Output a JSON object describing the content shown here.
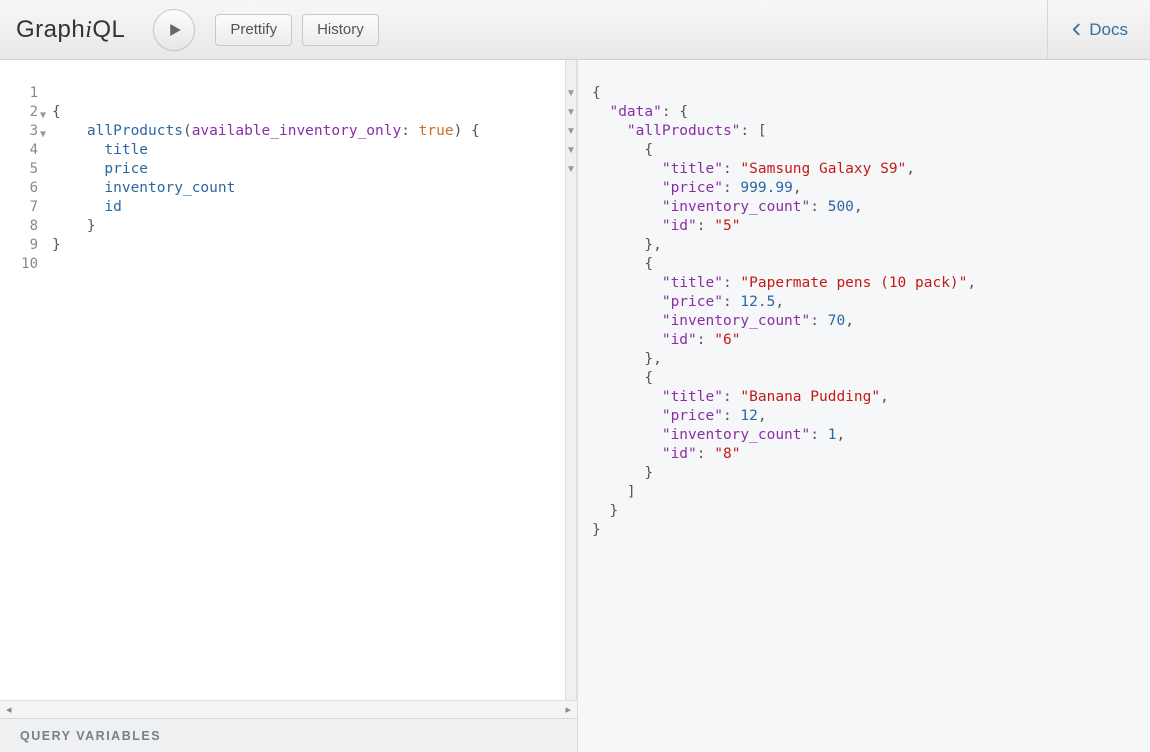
{
  "header": {
    "logo_pre": "Graph",
    "logo_i": "i",
    "logo_post": "QL",
    "prettify_label": "Prettify",
    "history_label": "History",
    "docs_label": "Docs"
  },
  "editor": {
    "line_count": 10,
    "fold_lines": [
      2,
      3
    ],
    "query_tokens": [
      [],
      [
        {
          "t": "punc",
          "v": "{"
        }
      ],
      [
        {
          "t": "indent",
          "v": "    "
        },
        {
          "t": "field",
          "v": "allProducts"
        },
        {
          "t": "punc",
          "v": "("
        },
        {
          "t": "arg",
          "v": "available_inventory_only"
        },
        {
          "t": "punc",
          "v": ": "
        },
        {
          "t": "kw",
          "v": "true"
        },
        {
          "t": "punc",
          "v": ") {"
        }
      ],
      [
        {
          "t": "indent",
          "v": "      "
        },
        {
          "t": "field",
          "v": "title"
        }
      ],
      [
        {
          "t": "indent",
          "v": "      "
        },
        {
          "t": "field",
          "v": "price"
        }
      ],
      [
        {
          "t": "indent",
          "v": "      "
        },
        {
          "t": "field",
          "v": "inventory_count"
        }
      ],
      [
        {
          "t": "indent",
          "v": "      "
        },
        {
          "t": "field",
          "v": "id"
        }
      ],
      [
        {
          "t": "indent",
          "v": "    "
        },
        {
          "t": "punc",
          "v": "}"
        }
      ],
      [
        {
          "t": "punc",
          "v": "}"
        }
      ],
      []
    ],
    "right_fold_markers": [
      1,
      2,
      4,
      10,
      16
    ]
  },
  "variables_label": "QUERY VARIABLES",
  "result": {
    "root_key": "data",
    "list_key": "allProducts",
    "items": [
      {
        "title": "Samsung Galaxy S9",
        "price": 999.99,
        "inventory_count": 500,
        "id": "5"
      },
      {
        "title": "Papermate pens (10 pack)",
        "price": 12.5,
        "inventory_count": 70,
        "id": "6"
      },
      {
        "title": "Banana Pudding",
        "price": 12,
        "inventory_count": 1,
        "id": "8"
      }
    ]
  }
}
